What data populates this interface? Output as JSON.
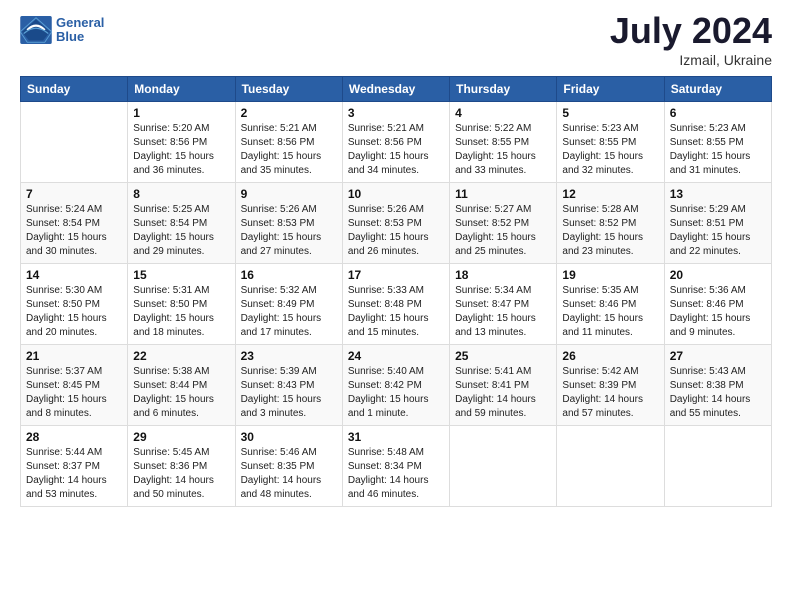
{
  "header": {
    "logo_line1": "General",
    "logo_line2": "Blue",
    "month_year": "July 2024",
    "location": "Izmail, Ukraine"
  },
  "weekdays": [
    "Sunday",
    "Monday",
    "Tuesday",
    "Wednesday",
    "Thursday",
    "Friday",
    "Saturday"
  ],
  "weeks": [
    [
      {
        "day": "",
        "info": ""
      },
      {
        "day": "1",
        "info": "Sunrise: 5:20 AM\nSunset: 8:56 PM\nDaylight: 15 hours\nand 36 minutes."
      },
      {
        "day": "2",
        "info": "Sunrise: 5:21 AM\nSunset: 8:56 PM\nDaylight: 15 hours\nand 35 minutes."
      },
      {
        "day": "3",
        "info": "Sunrise: 5:21 AM\nSunset: 8:56 PM\nDaylight: 15 hours\nand 34 minutes."
      },
      {
        "day": "4",
        "info": "Sunrise: 5:22 AM\nSunset: 8:55 PM\nDaylight: 15 hours\nand 33 minutes."
      },
      {
        "day": "5",
        "info": "Sunrise: 5:23 AM\nSunset: 8:55 PM\nDaylight: 15 hours\nand 32 minutes."
      },
      {
        "day": "6",
        "info": "Sunrise: 5:23 AM\nSunset: 8:55 PM\nDaylight: 15 hours\nand 31 minutes."
      }
    ],
    [
      {
        "day": "7",
        "info": "Sunrise: 5:24 AM\nSunset: 8:54 PM\nDaylight: 15 hours\nand 30 minutes."
      },
      {
        "day": "8",
        "info": "Sunrise: 5:25 AM\nSunset: 8:54 PM\nDaylight: 15 hours\nand 29 minutes."
      },
      {
        "day": "9",
        "info": "Sunrise: 5:26 AM\nSunset: 8:53 PM\nDaylight: 15 hours\nand 27 minutes."
      },
      {
        "day": "10",
        "info": "Sunrise: 5:26 AM\nSunset: 8:53 PM\nDaylight: 15 hours\nand 26 minutes."
      },
      {
        "day": "11",
        "info": "Sunrise: 5:27 AM\nSunset: 8:52 PM\nDaylight: 15 hours\nand 25 minutes."
      },
      {
        "day": "12",
        "info": "Sunrise: 5:28 AM\nSunset: 8:52 PM\nDaylight: 15 hours\nand 23 minutes."
      },
      {
        "day": "13",
        "info": "Sunrise: 5:29 AM\nSunset: 8:51 PM\nDaylight: 15 hours\nand 22 minutes."
      }
    ],
    [
      {
        "day": "14",
        "info": "Sunrise: 5:30 AM\nSunset: 8:50 PM\nDaylight: 15 hours\nand 20 minutes."
      },
      {
        "day": "15",
        "info": "Sunrise: 5:31 AM\nSunset: 8:50 PM\nDaylight: 15 hours\nand 18 minutes."
      },
      {
        "day": "16",
        "info": "Sunrise: 5:32 AM\nSunset: 8:49 PM\nDaylight: 15 hours\nand 17 minutes."
      },
      {
        "day": "17",
        "info": "Sunrise: 5:33 AM\nSunset: 8:48 PM\nDaylight: 15 hours\nand 15 minutes."
      },
      {
        "day": "18",
        "info": "Sunrise: 5:34 AM\nSunset: 8:47 PM\nDaylight: 15 hours\nand 13 minutes."
      },
      {
        "day": "19",
        "info": "Sunrise: 5:35 AM\nSunset: 8:46 PM\nDaylight: 15 hours\nand 11 minutes."
      },
      {
        "day": "20",
        "info": "Sunrise: 5:36 AM\nSunset: 8:46 PM\nDaylight: 15 hours\nand 9 minutes."
      }
    ],
    [
      {
        "day": "21",
        "info": "Sunrise: 5:37 AM\nSunset: 8:45 PM\nDaylight: 15 hours\nand 8 minutes."
      },
      {
        "day": "22",
        "info": "Sunrise: 5:38 AM\nSunset: 8:44 PM\nDaylight: 15 hours\nand 6 minutes."
      },
      {
        "day": "23",
        "info": "Sunrise: 5:39 AM\nSunset: 8:43 PM\nDaylight: 15 hours\nand 3 minutes."
      },
      {
        "day": "24",
        "info": "Sunrise: 5:40 AM\nSunset: 8:42 PM\nDaylight: 15 hours\nand 1 minute."
      },
      {
        "day": "25",
        "info": "Sunrise: 5:41 AM\nSunset: 8:41 PM\nDaylight: 14 hours\nand 59 minutes."
      },
      {
        "day": "26",
        "info": "Sunrise: 5:42 AM\nSunset: 8:39 PM\nDaylight: 14 hours\nand 57 minutes."
      },
      {
        "day": "27",
        "info": "Sunrise: 5:43 AM\nSunset: 8:38 PM\nDaylight: 14 hours\nand 55 minutes."
      }
    ],
    [
      {
        "day": "28",
        "info": "Sunrise: 5:44 AM\nSunset: 8:37 PM\nDaylight: 14 hours\nand 53 minutes."
      },
      {
        "day": "29",
        "info": "Sunrise: 5:45 AM\nSunset: 8:36 PM\nDaylight: 14 hours\nand 50 minutes."
      },
      {
        "day": "30",
        "info": "Sunrise: 5:46 AM\nSunset: 8:35 PM\nDaylight: 14 hours\nand 48 minutes."
      },
      {
        "day": "31",
        "info": "Sunrise: 5:48 AM\nSunset: 8:34 PM\nDaylight: 14 hours\nand 46 minutes."
      },
      {
        "day": "",
        "info": ""
      },
      {
        "day": "",
        "info": ""
      },
      {
        "day": "",
        "info": ""
      }
    ]
  ]
}
